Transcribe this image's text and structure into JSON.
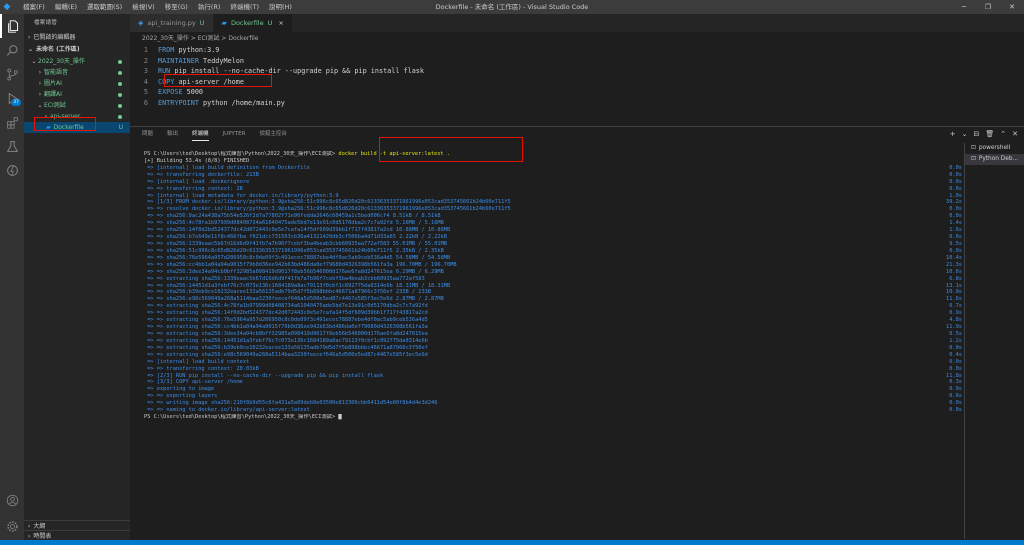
{
  "window": {
    "title": "Dockerfile - 未命名 (工作區) - Visual Studio Code",
    "menu": [
      "檔案(F)",
      "編輯(E)",
      "選取範圍(S)",
      "檢視(V)",
      "移至(G)",
      "執行(R)",
      "終端機(T)",
      "說明(H)"
    ],
    "controls": [
      "─",
      "❐",
      "✕"
    ]
  },
  "activity": {
    "items": [
      "files-icon",
      "search-icon",
      "source-control-icon",
      "run-debug-icon",
      "extensions-icon",
      "test-icon",
      "remote-icon"
    ],
    "badge": "37",
    "bottom": [
      "account-icon",
      "settings-icon"
    ]
  },
  "sidebar": {
    "title": "檔案總管",
    "open_editors": "已開啟的編輯器",
    "workspace": "未命名 (工作區)",
    "tree": [
      {
        "label": "2022_30天_操作",
        "chev": "⌄",
        "depth": 0,
        "mark": "dot"
      },
      {
        "label": "智能語音",
        "chev": "›",
        "depth": 1,
        "mark": "dot"
      },
      {
        "label": "圖片AI",
        "chev": "›",
        "depth": 1,
        "mark": "dot"
      },
      {
        "label": "翻譯AI",
        "chev": "›",
        "depth": 1,
        "mark": "dot"
      },
      {
        "label": "ECI測試",
        "chev": "⌄",
        "depth": 1,
        "mark": "dot"
      },
      {
        "label": "api-server",
        "chev": "›",
        "depth": 2,
        "mark": "dot"
      },
      {
        "label": "Dockerfile",
        "chev": "",
        "depth": 2,
        "mark": "U"
      }
    ],
    "outline": "大綱",
    "timeline": "時間表"
  },
  "editor": {
    "tabs": [
      {
        "label": "api_training.py",
        "status": "U",
        "icon": "python-icon"
      },
      {
        "label": "Dockerfile",
        "status": "U",
        "icon": "docker-icon",
        "close": "×"
      }
    ],
    "breadcrumb": "2022_30天_操作 > ECI測試 > Dockerfile",
    "lines": [
      {
        "n": "1",
        "kw": "FROM",
        "rest": " python:3.9"
      },
      {
        "n": "2",
        "kw": "MAINTAINER",
        "rest": " TeddyMelon"
      },
      {
        "n": "3",
        "kw": "RUN",
        "rest": " pip install --no-cache-dir --upgrade pip && pip install flask"
      },
      {
        "n": "4",
        "kw": "COPY",
        "rest": " api-server /home"
      },
      {
        "n": "5",
        "kw": "EXPOSE",
        "rest": " 5000"
      },
      {
        "n": "6",
        "kw": "ENTRYPOINT",
        "rest": " python /home/main.py"
      }
    ]
  },
  "panel": {
    "tabs": [
      "問題",
      "輸出",
      "終端機",
      "JUPYTER",
      "偵錯主控台"
    ],
    "active_tab": "終端機",
    "controls": [
      "+",
      "⌄",
      "⊟",
      "🗑",
      "⌃",
      "✕"
    ],
    "terminals": [
      {
        "label": "powershell",
        "icon": "terminal-icon"
      },
      {
        "label": "Python Deb...",
        "icon": "terminal-icon"
      }
    ],
    "prompt": "PS C:\\Users\\ted\\Desktop\\程式練習\\Python\\2022_30天_操作\\ECI測試> ",
    "command": "docker build -t api-server:latest .",
    "lines": [
      {
        "t": "[+] Building 53.4s (8/8) FINISHED",
        "tm": "",
        "c": "w"
      },
      {
        "t": " => [internal] load build definition from Dockerfile",
        "tm": "0.0s",
        "c": "b"
      },
      {
        "t": " => => transferring dockerfile: 213B",
        "tm": "0.0s",
        "c": "b"
      },
      {
        "t": " => [internal] load .dockerignore",
        "tm": "0.0s",
        "c": "b"
      },
      {
        "t": " => => transferring context: 2B",
        "tm": "0.0s",
        "c": "b"
      },
      {
        "t": " => [internal] load metadata for docker.io/library/python:3.9",
        "tm": "1.0s",
        "c": "b"
      },
      {
        "t": " => [1/3] FROM docker.io/library/python:3.9@sha256:51c996c8c65d826d20c61336353371961996e053cad353745661b24b60e711f5",
        "tm": "39.2s",
        "c": "b"
      },
      {
        "t": " => => resolve docker.io/library/python:3.9@sha256:51c996c8c65d826d20c61336353371961996e053cad353745661b24b60e711f5",
        "tm": "0.0s",
        "c": "b"
      },
      {
        "t": " => => sha256:9ac24a438a75b54e526f2d7a77802f71e96fedda2646c60459a1c5bed006cf4 8.51kB / 8.51kB",
        "tm": "0.0s",
        "c": "b"
      },
      {
        "t": " => => sha256:4c78fa1b97999d08408734a61040475ade5bd7e13e91c0d5170dba2c7c7a92fd 5.16MB / 5.16MB",
        "tm": "1.4s",
        "c": "b"
      },
      {
        "t": " => => sha256:14f0d2bd524377dc42d072443c0e5e7cafa14f5df609d39bb1f717f43817a2cd 10.88MB / 10.88MB",
        "tm": "1.6s",
        "c": "b"
      },
      {
        "t": " => => sha256:b7e649e11f8c466fba f021dcc731563cb36a41321420db3cf506ba4d71d33a65 2.22kB / 2.22kB",
        "tm": "0.0s",
        "c": "b"
      },
      {
        "t": " => => sha256:1339eaac5b67d16d6d9f41fb7a7b96f7cebf3ba4beab3cbb60935aa772af583 55.01MB / 55.01MB",
        "tm": "9.5s",
        "c": "b"
      },
      {
        "t": " => => sha256:51c996c8c65d826d20c61336353371961996e053cad353745661b24b60e711f5 2.35kB / 2.35kB",
        "tm": "0.0s",
        "c": "b"
      },
      {
        "t": " => => sha256:76e5964a957d206950c8c0de09f3c491ecec78887ebe4df0ac5ab9ceb536a4d5 54.58MB / 54.58MB",
        "tm": "10.4s",
        "c": "b"
      },
      {
        "t": " => => sha256:cc4bb1a04a94a9015f79b0d36ee942b63bd486da0ef79680d4326398b561fa3a 196.70MB / 196.70MB",
        "tm": "21.3s",
        "c": "b"
      },
      {
        "t": " => => sha256:3dee34a94cb0bff32985a098419d9017f8eb56b546000d176ae6fa8d247615ea 6.29MB / 6.29MB",
        "tm": "10.6s",
        "c": "b"
      },
      {
        "t": " => => extracting sha256:1339eaac5b67d16d6d9f41fb7a7b96f7cebf3ba4beab3cbb60935aa772af583",
        "tm": "6.8s",
        "c": "b"
      },
      {
        "t": " => => sha256:14451d1a3febf76c7c073e136c1684189a8ac79113f0cbf1c892775da8314e6b 18.31MB / 18.31MB",
        "tm": "13.1s",
        "c": "b"
      },
      {
        "t": " => => sha256:b39eb9ce10232eacee133a56135adb79d5d7f5b898bbbc46671a87966c3f50ef 233B / 233B",
        "tm": "10.9s",
        "c": "b"
      },
      {
        "t": " => => sha256:e98c569049a268a5114baa3230feecef646a5d500e5ed87c4467e585f3ec5e6d 2.87MB / 2.87MB",
        "tm": "11.6s",
        "c": "b"
      },
      {
        "t": " => => extracting sha256:4c78fa1b97999d08408734a61040475ade5bd7e13e91c0d5170dba2c7c7a92fd",
        "tm": "0.7s",
        "c": "b"
      },
      {
        "t": " => => extracting sha256:14f0d2bd524377dc42d072443c0e5e7cafa14f5df609d39bb1f717f43817a2cd",
        "tm": "0.9s",
        "c": "b"
      },
      {
        "t": " => => extracting sha256:76e5964a957d206950c8c0de09f3c491ecec78887ebe4df0ac5ab9ceb536a4d5",
        "tm": "4.8s",
        "c": "b"
      },
      {
        "t": " => => extracting sha256:cc4bb1a04a94a9015f79b0d36ee942b63bd486da0ef79680d4326398b561fa3a",
        "tm": "11.9s",
        "c": "b"
      },
      {
        "t": " => => extracting sha256:3dee34a94cb0bff32985a098419d9017f8eb56b546000d176ae6fa8d247615ea",
        "tm": "0.5s",
        "c": "b"
      },
      {
        "t": " => => extracting sha256:14451d1a3febf76c7c073e136c1684189a8ac79113f0cbf1c892775da8314e6b",
        "tm": "1.2s",
        "c": "b"
      },
      {
        "t": " => => extracting sha256:b39eb9ce10232eacee133a56135adb79d5d7f5b898bbbc46671a87966c3f50ef",
        "tm": "0.0s",
        "c": "b"
      },
      {
        "t": " => => extracting sha256:e98c569049a268a5114baa3230feecef646a5d500e5ed87c4467e585f3ec5e6d",
        "tm": "0.4s",
        "c": "b"
      },
      {
        "t": " => [internal] load build context",
        "tm": "0.0s",
        "c": "b"
      },
      {
        "t": " => => transferring context: 20.03kB",
        "tm": "0.0s",
        "c": "b"
      },
      {
        "t": " => [2/3] RUN pip install --no-cache-dir --upgrade pip && pip install flask",
        "tm": "11.8s",
        "c": "b"
      },
      {
        "t": " => [3/3] COPY api-server /home",
        "tm": "0.3s",
        "c": "b"
      },
      {
        "t": " => exporting to image",
        "tm": "0.9s",
        "c": "b"
      },
      {
        "t": " => => exporting layers",
        "tm": "0.6s",
        "c": "b"
      },
      {
        "t": " => => writing image sha256:210f8b9d55c6fa431a5a09deb9e03500e813306cbb6411d54e60f8b4d4e3d246",
        "tm": "0.0s",
        "c": "b"
      },
      {
        "t": " => => naming to docker.io/library/api-server:latest",
        "tm": "0.0s",
        "c": "b"
      }
    ],
    "final_prompt": "PS C:\\Users\\ted\\Desktop\\程式練習\\Python\\2022_30天_操作\\ECI測試> ",
    "cursor": "█"
  },
  "colors": {
    "accent": "#007acc",
    "highlight": "#e51400",
    "untracked": "#73c991"
  }
}
